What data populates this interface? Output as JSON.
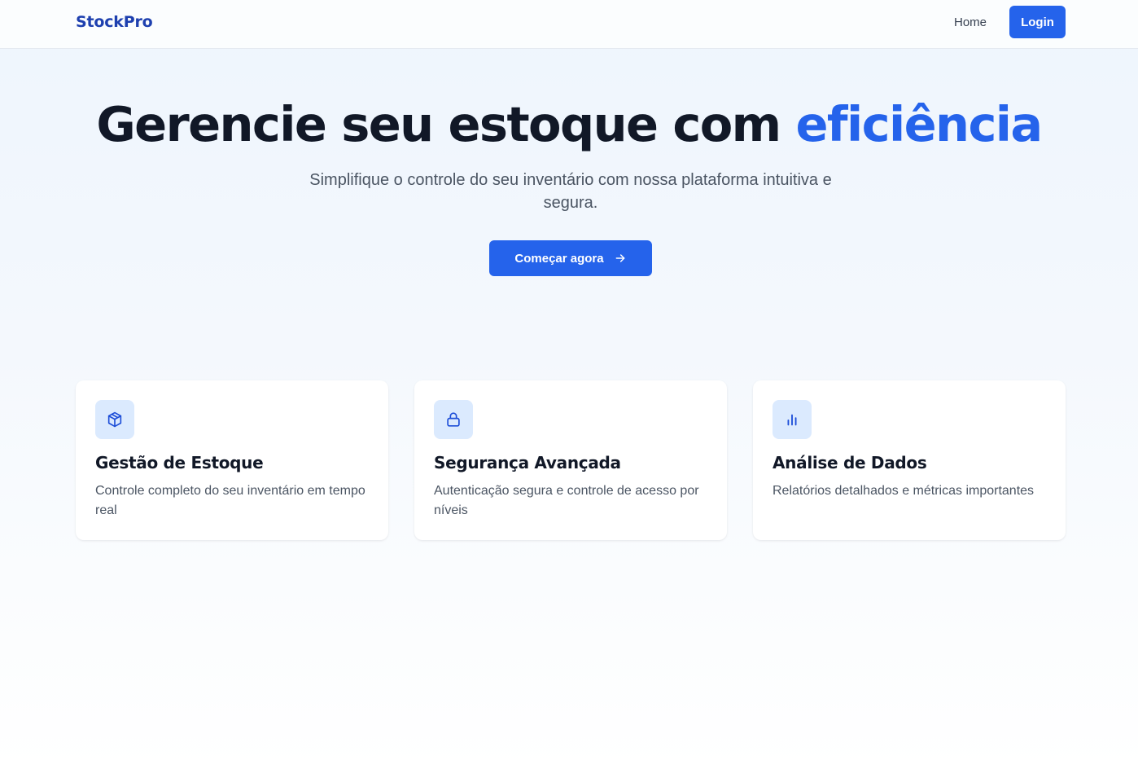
{
  "nav": {
    "logo": "StockPro",
    "home_label": "Home",
    "login_label": "Login"
  },
  "hero": {
    "title_main": "Gerencie seu estoque com ",
    "title_accent": "eficiência",
    "subtitle": "Simplifique o controle do seu inventário com nossa plataforma intuitiva e segura.",
    "cta_label": "Começar agora",
    "cta_icon": "arrow-right-icon"
  },
  "features": [
    {
      "icon": "box-icon",
      "title": "Gestão de Estoque",
      "description": "Controle completo do seu inventário em tempo real"
    },
    {
      "icon": "lock-icon",
      "title": "Segurança Avançada",
      "description": "Autenticação segura e controle de acesso por níveis"
    },
    {
      "icon": "bar-chart-icon",
      "title": "Análise de Dados",
      "description": "Relatórios detalhados e métricas importantes"
    }
  ],
  "colors": {
    "primary": "#2563eb",
    "logo": "#1e40af",
    "heading": "#111827",
    "body_text": "#4b5563",
    "icon_bg": "#dbeafe"
  }
}
